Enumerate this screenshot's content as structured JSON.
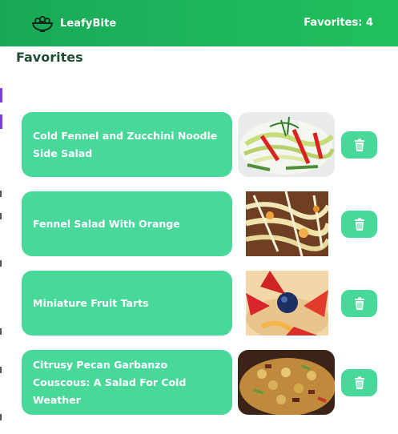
{
  "app": {
    "brand_name": "LeafyBite",
    "brand_icon": "salad-bowl-icon",
    "favorites_label": "Favorites: 4",
    "accent_color": "#22c05d",
    "card_color": "#48d89a"
  },
  "page": {
    "title": "Favorites"
  },
  "favorites": [
    {
      "title": "Cold Fennel and Zucchini Noodle Side Salad",
      "image": "zucchini-noodle-salad-photo",
      "action_icon": "trash-icon"
    },
    {
      "title": "Fennel Salad With Orange",
      "image": "fennel-orange-salad-photo",
      "action_icon": "trash-icon"
    },
    {
      "title": "Miniature Fruit Tarts",
      "image": "fruit-tarts-photo",
      "action_icon": "trash-icon"
    },
    {
      "title": "Citrusy Pecan Garbanzo Couscous: A Salad For Cold Weather",
      "image": "garbanzo-couscous-photo",
      "action_icon": "trash-icon"
    }
  ]
}
